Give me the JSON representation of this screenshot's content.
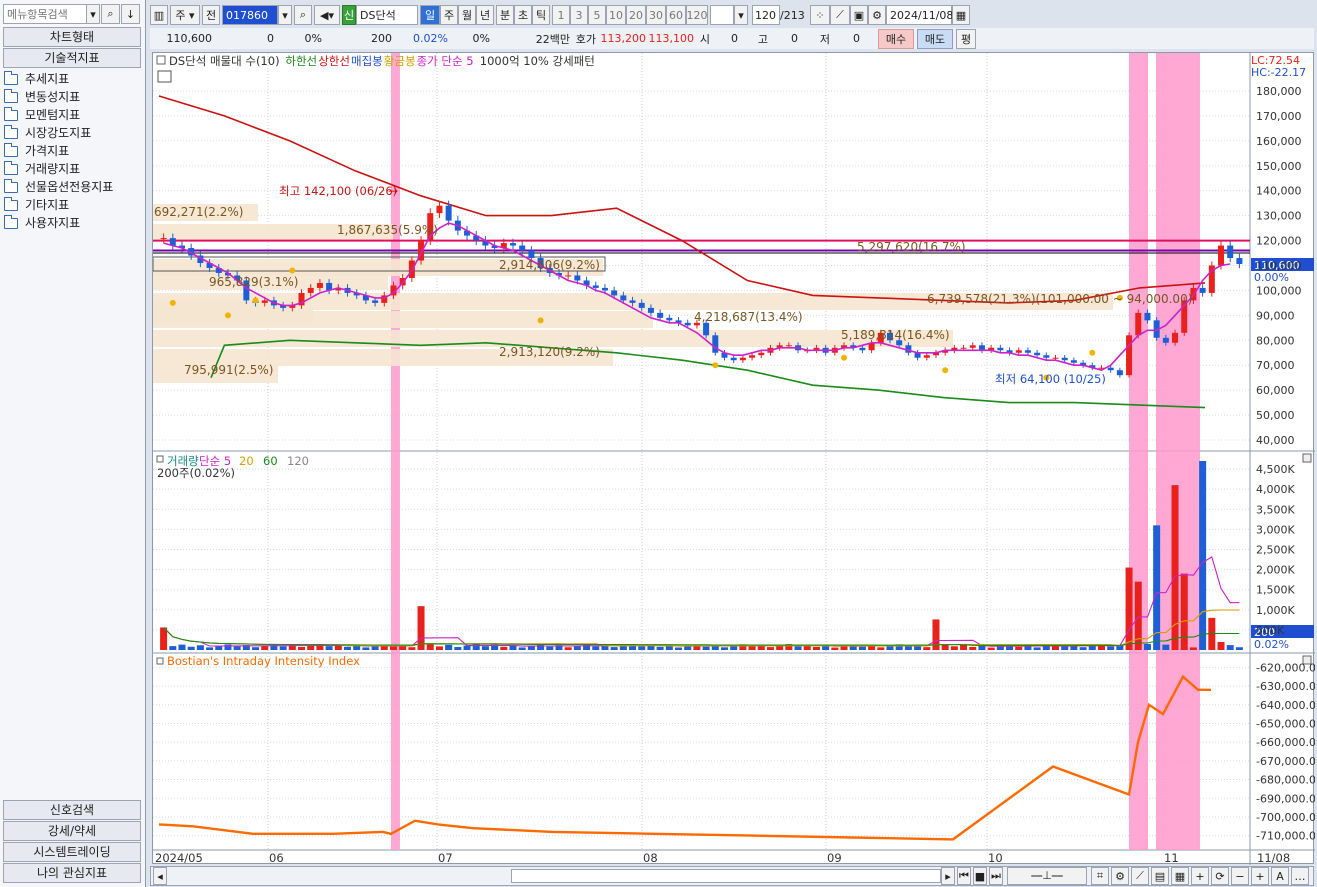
{
  "left": {
    "search_placeholder": "메뉴항목검색",
    "chart_type_header": "차트형태",
    "tech_indicator_header": "기술적지표",
    "tree": [
      "추세지표",
      "변동성지표",
      "모멘텀지표",
      "시장강도지표",
      "가격지표",
      "거래량지표",
      "선물옵션전용지표",
      "기타지표",
      "사용자지표"
    ],
    "bottom": [
      "신호검색",
      "강세/약세",
      "시스템트레이딩",
      "나의 관심지표"
    ]
  },
  "toolbar": {
    "market": "주",
    "prev": "전",
    "code": "017860",
    "tag": "신",
    "name": "DS단석",
    "periods": [
      "일",
      "주",
      "월",
      "년",
      "분",
      "초",
      "틱"
    ],
    "active_period": "일",
    "intervals": [
      "1",
      "3",
      "5",
      "10",
      "20",
      "30",
      "60",
      "120"
    ],
    "count": "120",
    "total": "/213",
    "date": "2024/11/08"
  },
  "quote": {
    "price": "110,600",
    "change": "0",
    "change_pct": "0%",
    "volume": "200",
    "vol_pct": "0.02%",
    "zero_pct": "0%",
    "trade_value": "22백만",
    "hoga_label": "호가",
    "ask": "113,200",
    "bid": "113,100",
    "open_label": "시",
    "open": "0",
    "high_label": "고",
    "high": "0",
    "low_label": "저",
    "low": "0",
    "buy": "매수",
    "sell": "매도",
    "avg": "평"
  },
  "price_panel": {
    "legend": [
      {
        "text": "DS단석 매물대 수(10)",
        "color": "#333333"
      },
      {
        "text": "하한선",
        "color": "#1a8a1a"
      },
      {
        "text": "상한선",
        "color": "#cc1111"
      },
      {
        "text": "매집봉",
        "color": "#1f4fd0"
      },
      {
        "text": "황금봉",
        "color": "#d4a000"
      },
      {
        "text": "종가 단순 5",
        "color": "#cc22cc"
      },
      {
        "text": "1000억 10% 강세패턴",
        "color": "#333333"
      }
    ],
    "lc": "LC:72.54",
    "hc": "HC:-22.17",
    "current_price": "110,600",
    "current_pct": "0.00%",
    "annotations": {
      "high": "최고 142,100 (06/26)",
      "low": "최저 64,100 (10/25)",
      "p1": "692,271(2.2%)",
      "p2": "1,867,635(5.9%)",
      "p3": "965,829(3.1%)",
      "p4": "2,914,606(9.2%)",
      "p5": "795,991(2.5%)",
      "p6": "5,297,620(16.7%)",
      "p7": "6,739,578(21.3%)(101,000.00 ~ 94,000.00)",
      "p8": "4,218,687(13.4%)",
      "p9": "5,189,814(16.4%)",
      "p10": "2,913,120(9.2%)"
    },
    "yticks": [
      "180,000",
      "170,000",
      "160,000",
      "150,000",
      "140,000",
      "130,000",
      "120,000",
      "110,000",
      "100,000",
      "90,000",
      "80,000",
      "70,000",
      "60,000",
      "50,000",
      "40,000"
    ]
  },
  "volume_panel": {
    "legend": [
      {
        "text": "거래량",
        "color": "#1a8a8a"
      },
      {
        "text": "단순 5",
        "color": "#cc22cc"
      },
      {
        "text": "20",
        "color": "#d4a000"
      },
      {
        "text": "60",
        "color": "#1a8a1a"
      },
      {
        "text": "120",
        "color": "#888888"
      }
    ],
    "subtitle": "200주(0.02%)",
    "current": "200",
    "current_pct": "0.02%",
    "yticks": [
      "4,500K",
      "4,000K",
      "3,500K",
      "3,000K",
      "2,500K",
      "2,000K",
      "1,500K",
      "1,000K",
      "500K"
    ]
  },
  "indicator_panel": {
    "title": "Bostian's Intraday Intensity Index",
    "yticks": [
      "-620,000.0",
      "-630,000.0",
      "-640,000.0",
      "-650,000.0",
      "-660,000.0",
      "-670,000.0",
      "-680,000.0",
      "-690,000.0",
      "-700,000.0",
      "-710,000.0"
    ]
  },
  "xaxis": [
    "2024/05",
    "06",
    "07",
    "08",
    "09",
    "10",
    "11",
    "11/08"
  ],
  "colors": {
    "up": "#e8211c",
    "down": "#1f5fd6",
    "ma5": "#cc22cc",
    "upper": "#cc1111",
    "lower": "#1a8a1a",
    "bii": "#ff6a00",
    "highlight": "#ff99cc"
  },
  "chart_data": [
    {
      "type": "candlestick",
      "title": "DS단석 일봉",
      "x_range": [
        "2024/05",
        "2024/11/08"
      ],
      "ylim": [
        40000,
        180000
      ],
      "close": [
        121000,
        118000,
        117000,
        114000,
        111000,
        109000,
        107000,
        106000,
        104000,
        96000,
        95000,
        96000,
        94000,
        93000,
        94000,
        99000,
        101000,
        103000,
        100000,
        101000,
        99000,
        98000,
        96000,
        95000,
        98000,
        102000,
        105000,
        112000,
        120000,
        131000,
        134000,
        128000,
        124000,
        122000,
        120000,
        118000,
        117000,
        119000,
        118000,
        116000,
        113000,
        109000,
        107000,
        106000,
        106000,
        104000,
        102000,
        101000,
        100000,
        98000,
        96000,
        95000,
        93000,
        91000,
        89000,
        88000,
        87000,
        86000,
        87000,
        82000,
        75000,
        73000,
        72000,
        73000,
        74000,
        75000,
        77000,
        78000,
        78000,
        76000,
        76000,
        77000,
        75000,
        77000,
        78000,
        77000,
        76000,
        79000,
        83000,
        80000,
        78000,
        75000,
        73000,
        74000,
        75000,
        76000,
        77000,
        77000,
        78000,
        76000,
        77000,
        76000,
        75000,
        76000,
        75000,
        74000,
        73000,
        73000,
        72000,
        71000,
        70000,
        69000,
        69000,
        68000,
        66000,
        82000,
        91000,
        88000,
        81000,
        79000,
        83000,
        96000,
        101000,
        99000,
        110000,
        118000,
        113000,
        110600
      ],
      "ma5": [
        119000,
        118000,
        117000,
        115000,
        113000,
        111000,
        109000,
        107000,
        104000,
        101000,
        99000,
        97000,
        95000,
        94000,
        94000,
        95000,
        97000,
        99000,
        100000,
        101000,
        100000,
        99000,
        98000,
        97000,
        97000,
        99000,
        103000,
        108000,
        115000,
        122000,
        125000,
        127000,
        126000,
        124000,
        122000,
        120000,
        118000,
        117000,
        116000,
        114000,
        112000,
        110000,
        108000,
        106000,
        104000,
        103000,
        102000,
        100000,
        99000,
        97000,
        95000,
        93000,
        91000,
        89000,
        88000,
        87000,
        87000,
        85000,
        83000,
        80000,
        77000,
        75000,
        74000,
        74000,
        75000,
        76000,
        76000,
        77000,
        77000,
        77000,
        76000,
        76000,
        76000,
        76000,
        77000,
        77000,
        78000,
        79000,
        79000,
        78000,
        77000,
        76000,
        75000,
        75000,
        75000,
        76000,
        76000,
        76000,
        76000,
        76000,
        76000,
        75000,
        75000,
        74000,
        74000,
        73000,
        72000,
        72000,
        71000,
        70000,
        70000,
        69000,
        68000,
        70000,
        74000,
        78000,
        82000,
        84000,
        84000,
        86000,
        90000,
        94000,
        98000,
        104000,
        108000,
        110000,
        110600
      ],
      "upper_band_approx": [
        178000,
        170000,
        160000,
        148000,
        138000,
        130000,
        130000,
        133000,
        120000,
        104000,
        98000,
        97000,
        96000,
        95000,
        96000,
        101000,
        103000
      ],
      "lower_band_approx": [
        65000,
        78000,
        80000,
        79000,
        78000,
        79000,
        77000,
        75000,
        72000,
        68000,
        62000,
        60000,
        57000,
        55000,
        55000,
        54000,
        53000
      ]
    },
    {
      "type": "bar",
      "title": "거래량",
      "unit": "K주",
      "ylim": [
        0,
        4800
      ],
      "spikes": [
        {
          "x": "2024/05",
          "value": 560
        },
        {
          "x": "06/26",
          "value": 1090
        },
        {
          "x": "09",
          "value": 760
        },
        {
          "x": "10/28",
          "value": 2050
        },
        {
          "x": "10/29",
          "value": 1700
        },
        {
          "x": "11/01",
          "value": 3100
        },
        {
          "x": "11/04",
          "value": 4100
        },
        {
          "x": "11/05",
          "value": 1900
        },
        {
          "x": "11/06",
          "value": 4700
        },
        {
          "x": "11/07",
          "value": 800
        },
        {
          "x": "11/08",
          "value": 200
        }
      ]
    },
    {
      "type": "line",
      "title": "Bostian's Intraday Intensity Index",
      "ylim": [
        -715000,
        -615000
      ],
      "values": [
        -704000,
        -705000,
        -709000,
        -709000,
        -708000,
        -709000,
        -707000,
        -702000,
        -704000,
        -706000,
        -708000,
        -709000,
        -710000,
        -711000,
        -712000,
        -673000,
        -688000,
        -660000,
        -640000,
        -645000,
        -625000,
        -632000,
        -632000
      ]
    }
  ]
}
